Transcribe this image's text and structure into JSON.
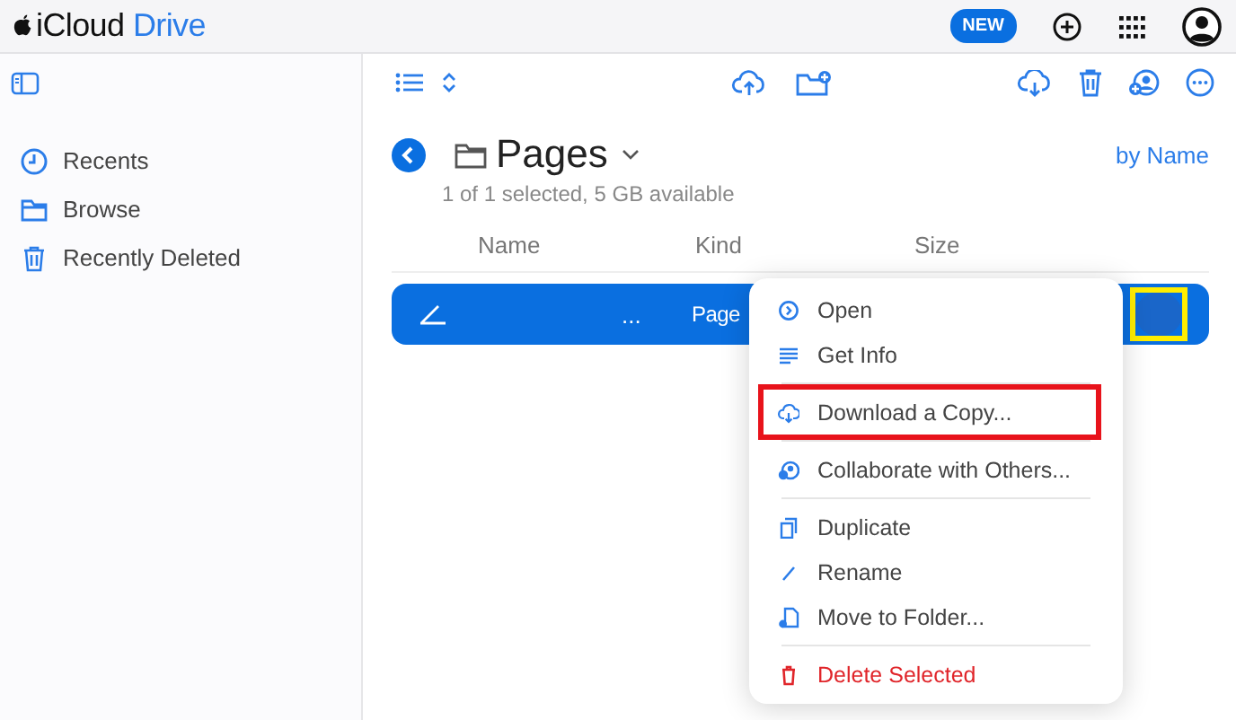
{
  "header": {
    "title": "iCloud",
    "title_accent": "Drive",
    "new_badge": "NEW"
  },
  "sidebar": {
    "items": [
      {
        "label": "Recents",
        "selected": false
      },
      {
        "label": "Browse",
        "selected": false
      },
      {
        "label": "Recently Deleted",
        "selected": false
      }
    ]
  },
  "folder": {
    "name": "Pages",
    "status": "1 of 1 selected, 5 GB available",
    "sort": "by Name"
  },
  "table": {
    "columns": [
      "Name",
      "Kind",
      "Size"
    ],
    "rows": [
      {
        "name": "...",
        "kind": "Page",
        "selected": true,
        "more_highlighted": true
      }
    ]
  },
  "context_menu": {
    "groups": [
      [
        {
          "label": "Open",
          "highlighted": false,
          "destructive": false
        },
        {
          "label": "Get Info",
          "highlighted": false,
          "destructive": false
        }
      ],
      [
        {
          "label": "Download a Copy...",
          "highlighted": true,
          "destructive": false
        }
      ],
      [
        {
          "label": "Collaborate with Others...",
          "highlighted": false,
          "destructive": false
        }
      ],
      [
        {
          "label": "Duplicate",
          "highlighted": false,
          "destructive": false
        },
        {
          "label": "Rename",
          "highlighted": false,
          "destructive": false
        },
        {
          "label": "Move to Folder...",
          "highlighted": false,
          "destructive": false
        }
      ],
      [
        {
          "label": "Delete Selected",
          "highlighted": false,
          "destructive": true
        }
      ]
    ]
  }
}
